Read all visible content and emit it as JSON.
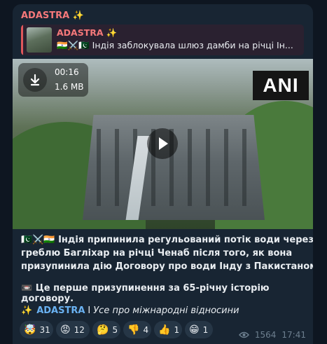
{
  "post": {
    "sender": "ADASTRA ✨",
    "reply": {
      "name": "ADASTRA ✨",
      "text": "🇮🇳⚔️🇵🇰 Індія заблокувала шлюз дамби на річці Ін..."
    },
    "media": {
      "duration": "00:16",
      "size": "1.6 MB",
      "watermark": "ANI"
    },
    "text_lines": [
      "🇵🇰⚔️🇮🇳 Індія припинила регульований потік води через",
      "греблю Багліхар на річці Ченаб після того, як вона",
      "призупинила дію Договору про води Інду з Пакистаном"
    ],
    "note": "📼 Це перше призупинення за 65-річну історію договору.",
    "footer": {
      "spark": "✨",
      "channel": "ADASTRA",
      "separator": "I",
      "category": "Усе про міжнародні відносини"
    },
    "reactions": [
      {
        "emoji": "🤯",
        "count": "31"
      },
      {
        "emoji": "😡",
        "count": "12"
      },
      {
        "emoji": "🤔",
        "count": "5"
      },
      {
        "emoji": "👎",
        "count": "4"
      },
      {
        "emoji": "👍",
        "count": "1"
      },
      {
        "emoji": "😁",
        "count": "1"
      }
    ],
    "views": "1564",
    "time": "17:41"
  },
  "colors": {
    "background": "#0e1621",
    "bubble": "#182533",
    "sender": "#f5787a",
    "link": "#6ab2f2"
  }
}
